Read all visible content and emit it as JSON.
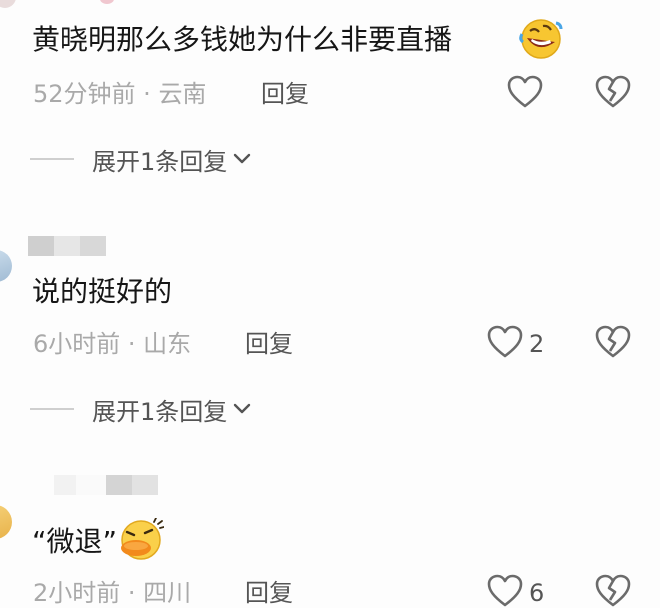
{
  "comments": [
    {
      "text": "黄晓明那么多钱她为什么非要直播",
      "time": "52分钟前",
      "location": "云南",
      "reply_label": "回复",
      "like_count": "",
      "expand_label": "展开1条回复",
      "emoji": "rolling-laughing-emoji"
    },
    {
      "text": "说的挺好的",
      "time": "6小时前",
      "location": "山东",
      "reply_label": "回复",
      "like_count": "2",
      "expand_label": "展开1条回复"
    },
    {
      "text": "“微退”",
      "time": "2小时前",
      "location": "四川",
      "reply_label": "回复",
      "like_count": "6",
      "emoji": "duck-emoji"
    }
  ],
  "separator": " · ",
  "colors": {
    "meta_gray": "#a9a9a9",
    "icon_gray": "#6b6b6b",
    "text_dark": "#161616"
  },
  "icons": [
    "heart-outline-icon",
    "broken-heart-icon",
    "chevron-down-icon"
  ]
}
